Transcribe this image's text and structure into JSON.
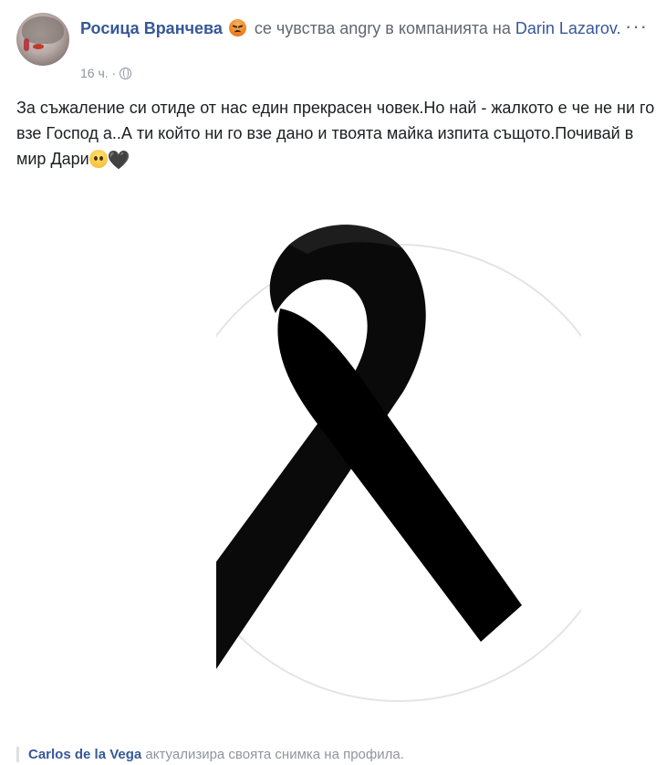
{
  "post": {
    "author": "Росица Врaнчева",
    "feeling_text": "се чувства angry в компанията на",
    "tagged_user": "Darin Lazarov.",
    "time": "16 ч.",
    "separator": "·",
    "feeling_icon": "angry-emoji-icon",
    "privacy_icon": "globe-icon",
    "more_label": "···",
    "text_main": "За съжаление си отиде от нас един прекрасен човек.Но най - жалкото е че не ни го взе Господ а..А ти който ни го взе дано и твоята майка изпита същото.Почивай в мир Дари",
    "emoji_sad": "sad-face-emoji-icon",
    "emoji_heart": "🖤",
    "image_icon": "black-mourning-ribbon-image"
  },
  "footer": {
    "name": "Carlos de la Vega",
    "action": "актуализира своята снимка на профила."
  },
  "colors": {
    "link": "#365899",
    "meta": "#90949c",
    "text": "#1c1e21",
    "ribbon": "#000000"
  }
}
